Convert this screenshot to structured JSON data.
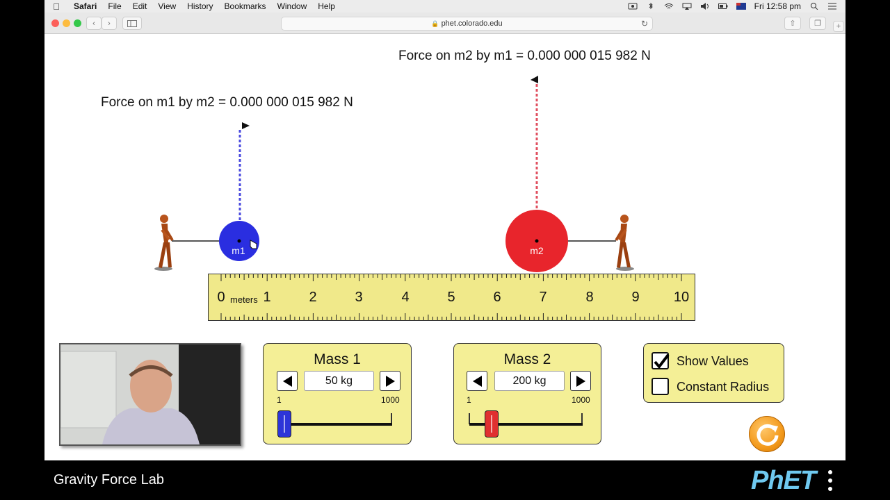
{
  "menubar": {
    "app": "Safari",
    "items": [
      "File",
      "Edit",
      "View",
      "History",
      "Bookmarks",
      "Window",
      "Help"
    ],
    "clock": "Fri 12:58 pm"
  },
  "browser": {
    "url": "phet.colorado.edu"
  },
  "sim": {
    "force_m1_label": "Force on m1 by m2 = 0.000 000 015 982 N",
    "force_m2_label": "Force on m2 by m1 = 0.000 000 015 982 N",
    "mass1_label": "m1",
    "mass2_label": "m2",
    "mass1_color": "#2a2ee0",
    "mass2_color": "#e8252c",
    "mass1_position_m": 0.4,
    "mass2_position_m": 6.9,
    "ruler": {
      "units": "meters",
      "ticks": [
        "0",
        "1",
        "2",
        "3",
        "4",
        "5",
        "6",
        "7",
        "8",
        "9",
        "10"
      ]
    }
  },
  "panels": {
    "mass1": {
      "title": "Mass 1",
      "value": "50 kg",
      "min_label": "1",
      "max_label": "1000",
      "thumb_color": "#2d35d8",
      "value_kg": 50
    },
    "mass2": {
      "title": "Mass 2",
      "value": "200 kg",
      "min_label": "1",
      "max_label": "1000",
      "thumb_color": "#e03030",
      "value_kg": 200
    }
  },
  "options": {
    "show_values_label": "Show Values",
    "show_values_checked": true,
    "constant_radius_label": "Constant Radius",
    "constant_radius_checked": false
  },
  "footer": {
    "title": "Gravity Force Lab",
    "logo": "PhET"
  }
}
